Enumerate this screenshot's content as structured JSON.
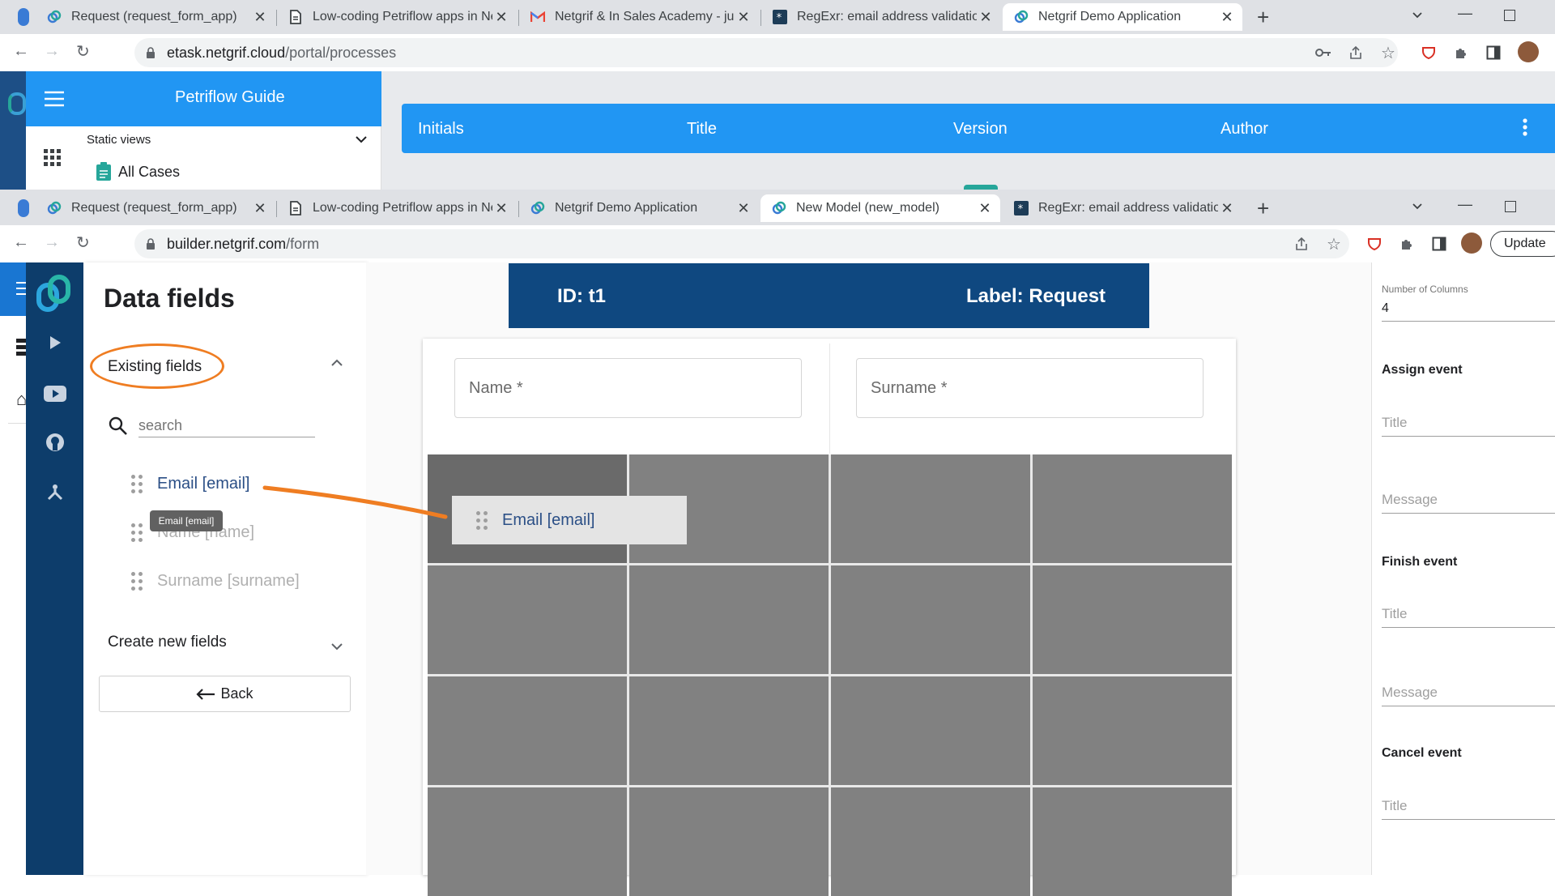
{
  "upper_window": {
    "tabs": [
      {
        "title": "Request (request_form_app)",
        "icon": "netgrif-logo-icon",
        "active": false
      },
      {
        "title": "Low-coding Petriflow apps in Net",
        "icon": "document-icon",
        "active": false
      },
      {
        "title": "Netgrif & In Sales Academy - juh",
        "icon": "gmail-icon",
        "active": false
      },
      {
        "title": "RegExr: email address validation",
        "icon": "regexr-icon",
        "active": false
      },
      {
        "title": "Netgrif Demo Application",
        "icon": "netgrif-logo-icon",
        "active": true
      }
    ],
    "url_host": "etask.netgrif.cloud",
    "url_path": "/portal/processes",
    "app": {
      "header_title": "Petriflow Guide",
      "static_views_label": "Static views",
      "all_cases_label": "All Cases",
      "table_columns": [
        "Initials",
        "Title",
        "Version",
        "Author"
      ]
    }
  },
  "lower_window": {
    "tabs": [
      {
        "title": "Request (request_form_app)",
        "icon": "netgrif-logo-icon",
        "active": false
      },
      {
        "title": "Low-coding Petriflow apps in Net",
        "icon": "document-icon",
        "active": false
      },
      {
        "title": "Netgrif Demo Application",
        "icon": "netgrif-logo-icon",
        "active": false
      },
      {
        "title": "New Model (new_model)",
        "icon": "netgrif-logo-icon",
        "active": true
      },
      {
        "title": "RegExr: email address validation",
        "icon": "regexr-icon",
        "active": false
      }
    ],
    "url_host": "builder.netgrif.com",
    "url_path": "/form",
    "update_button": "Update"
  },
  "builder": {
    "panel_title": "Data fields",
    "existing_fields_label": "Existing fields",
    "search_placeholder": "search",
    "fields": [
      {
        "label": "Email [email]",
        "state": "dragging"
      },
      {
        "label": "Name [name]",
        "state": "disabled"
      },
      {
        "label": "Surname [surname]",
        "state": "disabled"
      }
    ],
    "tooltip": "Email [email]",
    "create_fields_label": "Create new fields",
    "back_button": "Back",
    "transition_id": "ID: t1",
    "transition_label": "Label: Request",
    "form_inputs": [
      "Name *",
      "Surname *"
    ],
    "drag_ghost_label": "Email [email]",
    "right_panel": {
      "columns_label": "Number of Columns",
      "columns_value": "4",
      "assign_event": "Assign event",
      "finish_event": "Finish event",
      "cancel_event": "Cancel event",
      "title_placeholder": "Title",
      "message_placeholder": "Message"
    }
  },
  "colors": {
    "annotation": "#ef7d22",
    "primary_blue": "#2196f3",
    "banner_navy": "#0f4880",
    "rail_navy": "#0d3d6b"
  }
}
